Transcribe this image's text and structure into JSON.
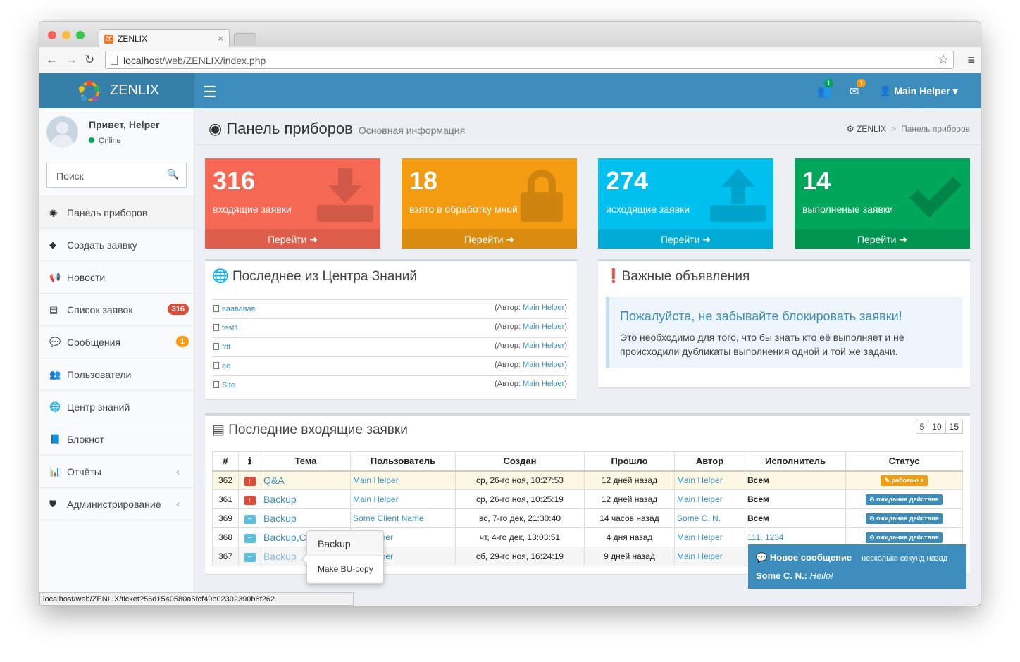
{
  "browser": {
    "tab_title": "ZENLIX",
    "url_host": "localhost",
    "url_path": "/web/ZENLIX/index.php",
    "status_url": "localhost/web/ZENLIX/ticket?56d1540580a5fcf49b02302390b6f262"
  },
  "header": {
    "logo": "ZENLIX",
    "users_badge": "1",
    "mail_badge": "1",
    "user": "Main Helper"
  },
  "sidebar": {
    "greeting": "Привет, Helper",
    "status": "Online",
    "search_placeholder": "Поиск",
    "items": [
      {
        "label": "Панель приборов",
        "icon": "dashboard-icon"
      },
      {
        "label": "Создать заявку",
        "icon": "tag-icon"
      },
      {
        "label": "Новости",
        "icon": "bullhorn-icon"
      },
      {
        "label": "Список заявок",
        "icon": "list-icon",
        "badge": "316"
      },
      {
        "label": "Сообщения",
        "icon": "comments-icon",
        "badge": "1"
      },
      {
        "label": "Пользователи",
        "icon": "users-icon"
      },
      {
        "label": "Центр знаний",
        "icon": "globe-icon"
      },
      {
        "label": "Блокнот",
        "icon": "book-icon"
      },
      {
        "label": "Отчёты",
        "icon": "bar-chart-icon"
      },
      {
        "label": "Администрирование",
        "icon": "shield-icon"
      }
    ]
  },
  "page": {
    "title": "Панель приборов",
    "subtitle": "Основная информация",
    "breadcrumb_home": "ZENLIX",
    "breadcrumb_current": "Панель приборов"
  },
  "stats": [
    {
      "value": "316",
      "label": "входящие заявки",
      "link": "Перейти",
      "color": "#f56954"
    },
    {
      "value": "18",
      "label": "взято в обработку мной",
      "link": "Перейти",
      "color": "#f39c12"
    },
    {
      "value": "274",
      "label": "исходящие заявки",
      "link": "Перейти",
      "color": "#00c0ef"
    },
    {
      "value": "14",
      "label": "выполненые заявки",
      "link": "Перейти",
      "color": "#00a65a"
    }
  ],
  "knowledge": {
    "title": "Последнее из Центра Знаний",
    "author_prefix": "(Автор: ",
    "author_suffix": ")",
    "items": [
      {
        "title": "ваававав",
        "author": "Main Helper"
      },
      {
        "title": "test1",
        "author": "Main Helper"
      },
      {
        "title": "fdf",
        "author": "Main Helper"
      },
      {
        "title": "ee",
        "author": "Main Helper"
      },
      {
        "title": "Site",
        "author": "Main Helper"
      }
    ]
  },
  "announcements": {
    "title": "Важные объявления",
    "headline": "Пожалуйста, не забывайте блокировать заявки!",
    "text": "Это необходимо для того, что бы знать кто её выполняет и не происходили дубликаты выполнения одной и той же задачи."
  },
  "tickets": {
    "title": "Последние входящие заявки",
    "page_sizes": [
      "5",
      "10",
      "15"
    ],
    "columns": [
      "#",
      "ℹ",
      "Тема",
      "Пользователь",
      "Создан",
      "Прошло",
      "Автор",
      "Исполнитель",
      "Статус"
    ],
    "rows": [
      {
        "id": "362",
        "priority": "high",
        "subject": "Q&A",
        "user": "Main Helper",
        "created": "ср, 26-го ноя, 10:27:53",
        "elapsed": "12 дней назад",
        "author": "Main Helper",
        "assignee": "Всем",
        "status": "работаю я",
        "status_color": "#f39c12"
      },
      {
        "id": "361",
        "priority": "high",
        "subject": "Backup",
        "user": "Main Helper",
        "created": "ср, 26-го ноя, 10:25:19",
        "elapsed": "12 дней назад",
        "author": "Main Helper",
        "assignee": "Всем",
        "status": "ожидания действия",
        "status_color": "#3c8dbc"
      },
      {
        "id": "369",
        "priority": "normal",
        "subject": "Backup",
        "user": "Some Client Name",
        "created": "вс, 7-го дек, 21:30:40",
        "elapsed": "14 часов назад",
        "author": "Some C. N.",
        "assignee": "Всем",
        "status": "ожидания действия",
        "status_color": "#3c8dbc"
      },
      {
        "id": "368",
        "priority": "normal",
        "subject": "Backup,C",
        "user": "lper",
        "created": "чт, 4-го дек, 13:03:51",
        "elapsed": "4 дня назад",
        "author": "Main Helper",
        "assignee": "111, 1234",
        "status": "ожидания действия",
        "status_color": "#3c8dbc"
      },
      {
        "id": "367",
        "priority": "normal",
        "subject": "Backup",
        "user": "lper",
        "created": "сб, 29-го ноя, 16:24:19",
        "elapsed": "9 дней назад",
        "author": "Main Helper",
        "assignee": "",
        "status": "",
        "status_color": ""
      }
    ]
  },
  "popover": {
    "title": "Backup",
    "body": "Make BU-copy"
  },
  "toast": {
    "title": "Новое сообщение",
    "time": "несколько секунд назад",
    "sender": "Some C. N.:",
    "message": "Hello!"
  }
}
